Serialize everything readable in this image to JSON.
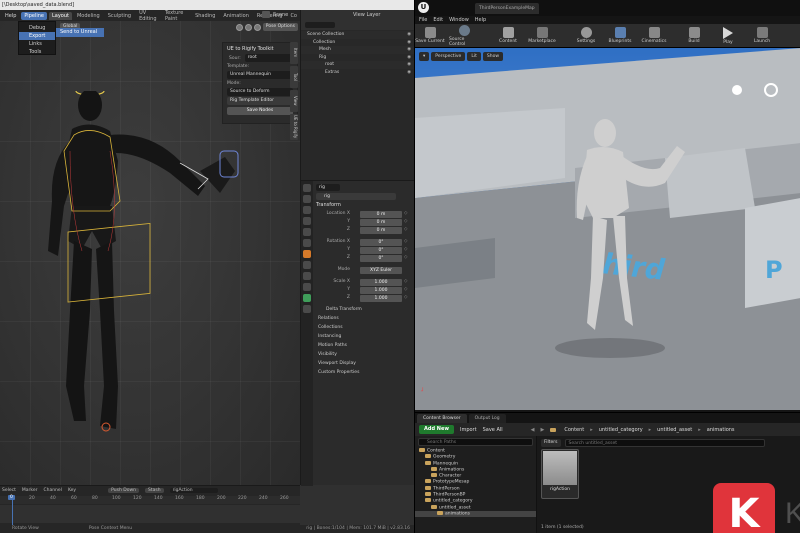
{
  "blender": {
    "title": "[\\Desktop\\saved_data.blend]",
    "menus": [
      "Help",
      "Pipeline"
    ],
    "tabs": [
      "Layout",
      "Modeling",
      "Sculpting",
      "UV Editing",
      "Texture Paint",
      "Shading",
      "Animation",
      "Rendering",
      "Co"
    ],
    "scene_label": "Scene",
    "view_layer_label": "View Layer",
    "pipeline_dropdown": [
      "Debug",
      "Export",
      "Links",
      "Tools"
    ],
    "pipeline_submenu": "Send to Unreal",
    "viewport": {
      "mode_button": "Global",
      "pose_options": "Pose Options"
    },
    "npanel": {
      "title": "UE to Rigify Toolkit",
      "source_label": "Sour:",
      "source_value": "root",
      "template_label": "Template:",
      "template_value": "Unreal Mannequin",
      "mode_label": "Mode:",
      "mode_value": "Source to Deform",
      "rig_template_editor": "Rig Template Editor",
      "save_nodes": "Save Nodes"
    },
    "side_tabs": [
      "Item",
      "Tool",
      "View",
      "UE to Rigify"
    ],
    "outliner": {
      "header": "Scene Collection",
      "rows": [
        "Collection",
        "Mesh",
        "Rig",
        "root",
        "Extras"
      ]
    },
    "properties": {
      "object_name": "rig",
      "object_name2": "rig",
      "transform_header": "Transform",
      "location": {
        "label": "Location X",
        "x": "0 m",
        "y": "0 m",
        "z": "0 m",
        "y_label": "Y",
        "z_label": "Z"
      },
      "rotation": {
        "label": "Rotation X",
        "x": "0°",
        "y": "0°",
        "z": "0°",
        "y_label": "Y",
        "z_label": "Z"
      },
      "mode": {
        "label": "Mode",
        "value": "XYZ Euler"
      },
      "scale": {
        "label": "Scale X",
        "x": "1.000",
        "y": "1.000",
        "z": "1.000",
        "y_label": "Y",
        "z_label": "Z"
      },
      "delta_transform": "Delta Transform",
      "sections": [
        "Relations",
        "Collections",
        "Instancing",
        "Motion Paths",
        "Visibility",
        "Viewport Display",
        "Custom Properties"
      ]
    },
    "timeline": {
      "menus": [
        "Select",
        "Marker",
        "Channel",
        "Key"
      ],
      "push_down": "Push Down",
      "stash": "Stash",
      "action": "rigAction",
      "ticks": [
        "0",
        "20",
        "40",
        "60",
        "80",
        "100",
        "120",
        "140",
        "160",
        "180",
        "200",
        "220",
        "240",
        "260"
      ],
      "current_frame": "0"
    },
    "status": {
      "left": "Rotate View",
      "middle": "Pose Context Menu",
      "right": "rig | Bones:1/104 | Mem: 101.7 MiB | v2.83.16"
    }
  },
  "unreal": {
    "project_tab": "ThirdPersonExampleMap",
    "menus": [
      "File",
      "Edit",
      "Window",
      "Help"
    ],
    "toolbar": [
      "Save Current",
      "Source Control",
      "Content",
      "Marketplace",
      "Settings",
      "Blueprints",
      "Cinematics",
      "Build",
      "Play",
      "Launch"
    ],
    "viewport_buttons": [
      "Perspective",
      "Lit",
      "Show"
    ],
    "content_browser": {
      "tabs": [
        "Content Browser",
        "Output Log"
      ],
      "add_new": "Add New",
      "import": "Import",
      "save_all": "Save All",
      "breadcrumb": [
        "Content",
        "untitled_category",
        "untitled_asset",
        "animations"
      ],
      "search_paths": "Search Paths",
      "tree": [
        {
          "label": "Content",
          "level": 0
        },
        {
          "label": "Geometry",
          "level": 1
        },
        {
          "label": "Mannequin",
          "level": 1
        },
        {
          "label": "Animations",
          "level": 2
        },
        {
          "label": "Character",
          "level": 2
        },
        {
          "label": "PrototypeMesap",
          "level": 1
        },
        {
          "label": "ThirdPerson",
          "level": 1
        },
        {
          "label": "ThirdPersonBP",
          "level": 1
        },
        {
          "label": "untitled_category",
          "level": 1
        },
        {
          "label": "untitled_asset",
          "level": 2
        },
        {
          "label": "animations",
          "level": 3
        }
      ],
      "filters": "Filters",
      "search_assets": "Search untitled_asset",
      "asset_name": "rigAction",
      "item_count": "1 item (1 selected)"
    },
    "watermark": {
      "letter": "K",
      "text": "KASHI"
    }
  },
  "colors": {
    "blender_accent": "#4772b3",
    "unreal_add_new": "#1f7a2d",
    "watermark_red": "#e0343b"
  }
}
